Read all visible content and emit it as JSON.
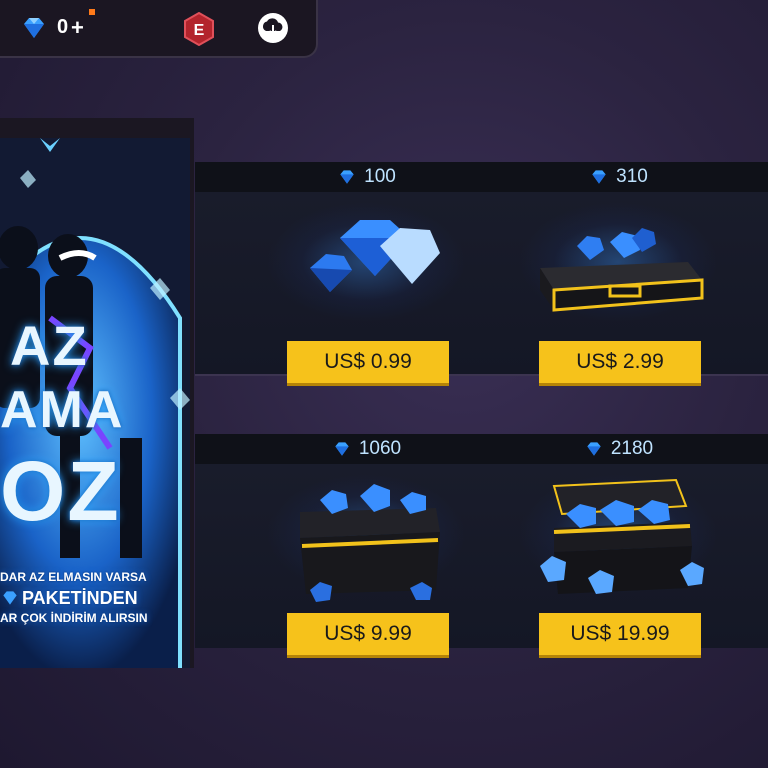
{
  "topbar": {
    "currency_value": "0",
    "plus_label": "+",
    "badge_letter": "E"
  },
  "banner": {
    "big_text_1": "AZ",
    "big_text_2": "AMA",
    "big_text_3": "OZ",
    "line1": "DAR AZ ELMASIN VARSA",
    "line2": "PAKETİNDEN",
    "line3": "AR ÇOK İNDİRİM ALIRSIN"
  },
  "packs": [
    {
      "amount": "100",
      "price": "US$ 0.99",
      "art": "diamond-pile"
    },
    {
      "amount": "310",
      "price": "US$ 2.99",
      "art": "briefcase"
    },
    {
      "amount": "1060",
      "price": "US$ 9.99",
      "art": "black-box"
    },
    {
      "amount": "2180",
      "price": "US$ 19.99",
      "art": "open-chest"
    }
  ],
  "colors": {
    "accent_gold": "#f6c21b",
    "diamond_blue": "#2e8bff",
    "panel_dark": "#141725"
  }
}
